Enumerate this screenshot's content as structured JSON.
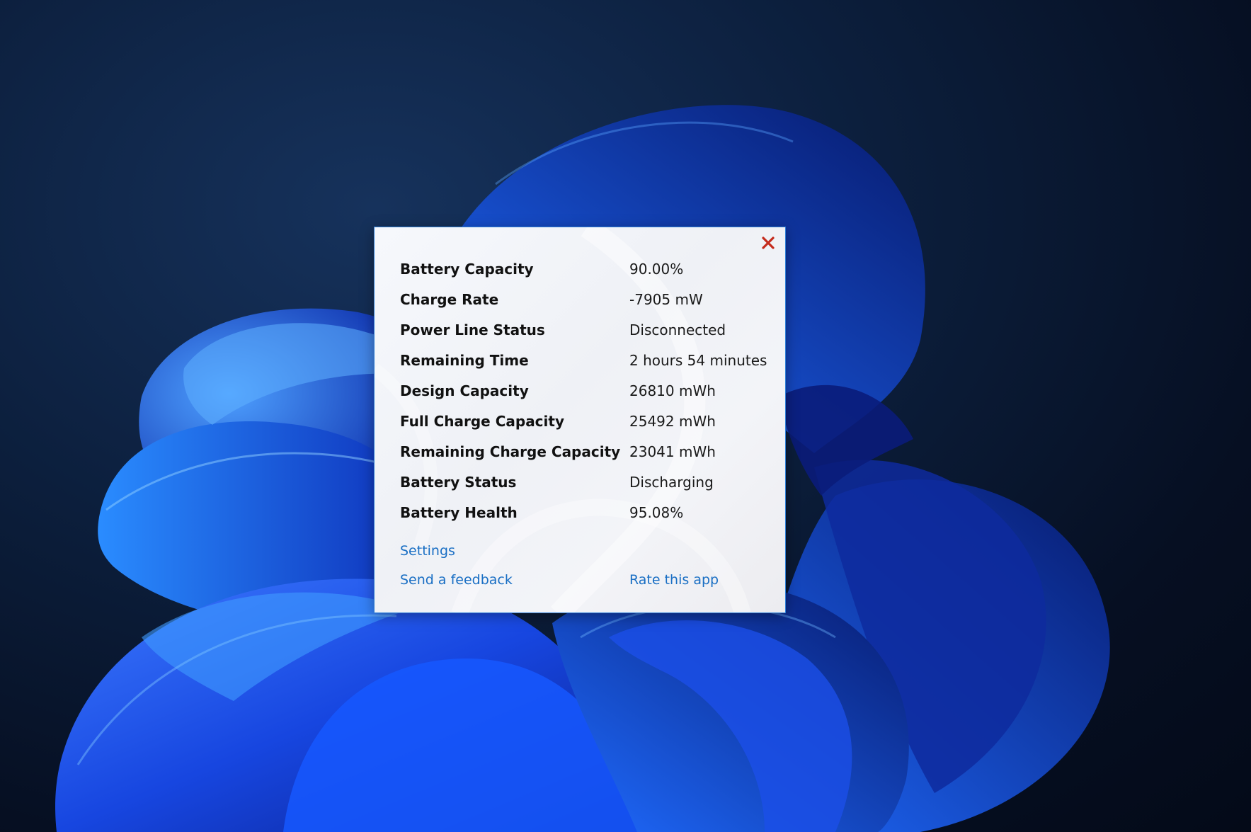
{
  "popup": {
    "rows": [
      {
        "label": "Battery Capacity",
        "value": "90.00%"
      },
      {
        "label": "Charge Rate",
        "value": "-7905 mW"
      },
      {
        "label": "Power Line Status",
        "value": "Disconnected"
      },
      {
        "label": "Remaining Time",
        "value": "2 hours 54 minutes"
      },
      {
        "label": "Design Capacity",
        "value": "26810 mWh"
      },
      {
        "label": "Full Charge Capacity",
        "value": "25492 mWh"
      },
      {
        "label": "Remaining Charge Capacity",
        "value": "23041 mWh"
      },
      {
        "label": "Battery Status",
        "value": "Discharging"
      },
      {
        "label": "Battery Health",
        "value": "95.08%"
      }
    ],
    "links": {
      "settings": "Settings",
      "feedback": "Send a feedback",
      "rate": "Rate this app"
    },
    "close_icon": "close-x-icon",
    "accent_color": "#1a6fc4",
    "close_color": "#c42b1c",
    "border_color": "#2f7fd6"
  }
}
